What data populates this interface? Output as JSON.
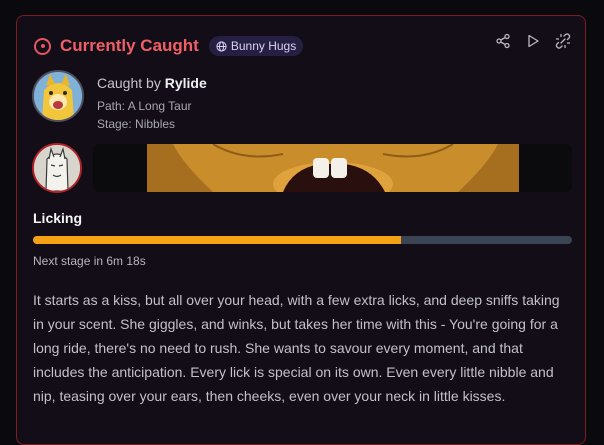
{
  "header": {
    "title": "Currently Caught",
    "badge": "Bunny Hugs",
    "status_color": "#e35560"
  },
  "toolbar": {
    "icons": [
      "share-icon",
      "play-icon",
      "unlink-icon"
    ]
  },
  "caught": {
    "prefix": "Caught by",
    "name": "Rylide",
    "path": "Path: A Long Taur",
    "stage": "Stage: Nibbles"
  },
  "current_stage": {
    "name": "Licking",
    "progress_fraction": 0.683,
    "next_stage": "Next stage in 6m 18s",
    "progress_color": "#f5a116"
  },
  "description": "It starts as a kiss, but all over your head, with a few extra licks, and deep sniffs taking in your scent. She giggles, and winks, but takes her time with this - You're going for a long ride, there's no need to rush. She wants to savour every moment, and that includes the anticipation. Every lick is special on its own. Even every little nibble and nip, teasing over your ears, then cheeks, even over your neck in little kisses."
}
